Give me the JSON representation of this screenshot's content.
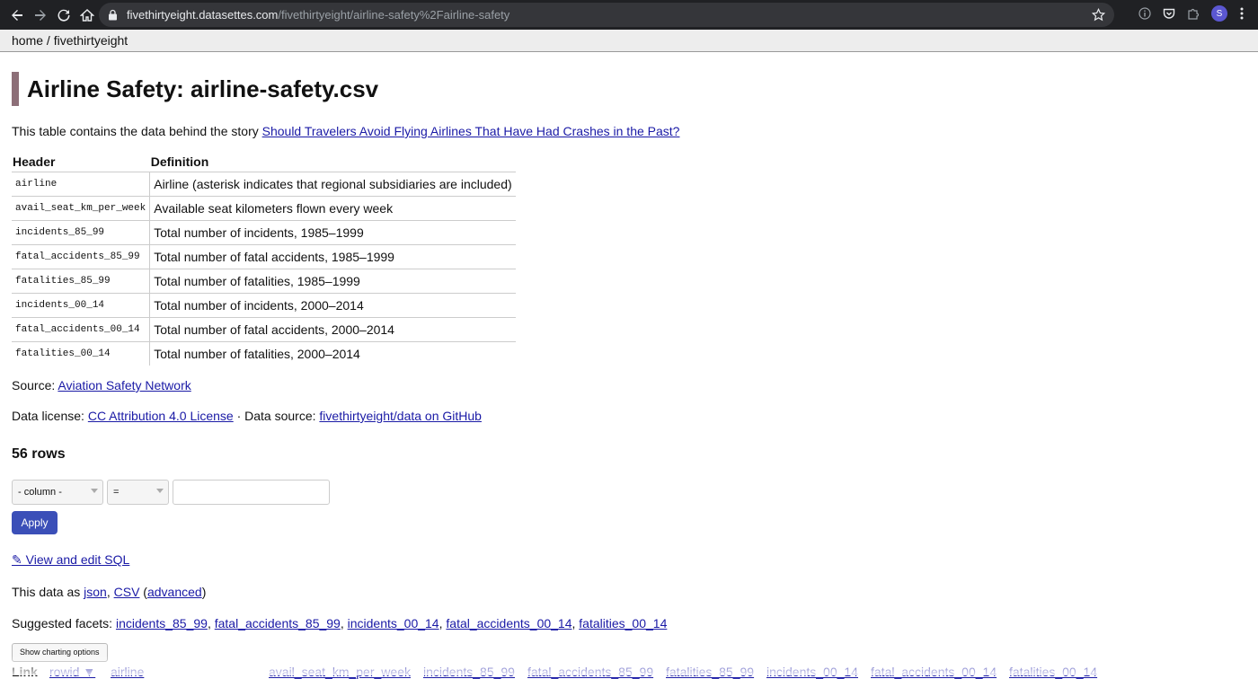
{
  "browser": {
    "url_host": "fivethirtyeight.datasettes.com",
    "url_path": "/fivethirtyeight/airline-safety%2Fairline-safety",
    "profile_initial": "S"
  },
  "breadcrumb": {
    "home": "home",
    "separator": " / ",
    "database": "fivethirtyeight"
  },
  "page": {
    "title": "Airline Safety: airline-safety.csv",
    "description_prefix": "This table contains the data behind the story ",
    "description_link": "Should Travelers Avoid Flying Airlines That Have Had Crashes in the Past?"
  },
  "definitions": {
    "headers": [
      "Header",
      "Definition"
    ],
    "rows": [
      {
        "name": "airline",
        "definition": "Airline (asterisk indicates that regional subsidiaries are included)"
      },
      {
        "name": "avail_seat_km_per_week",
        "definition": "Available seat kilometers flown every week"
      },
      {
        "name": "incidents_85_99",
        "definition": "Total number of incidents, 1985–1999"
      },
      {
        "name": "fatal_accidents_85_99",
        "definition": "Total number of fatal accidents, 1985–1999"
      },
      {
        "name": "fatalities_85_99",
        "definition": "Total number of fatalities, 1985–1999"
      },
      {
        "name": "incidents_00_14",
        "definition": "Total number of incidents, 2000–2014"
      },
      {
        "name": "fatal_accidents_00_14",
        "definition": "Total number of fatal accidents, 2000–2014"
      },
      {
        "name": "fatalities_00_14",
        "definition": "Total number of fatalities, 2000–2014"
      }
    ]
  },
  "source": {
    "label": "Source: ",
    "link": "Aviation Safety Network"
  },
  "license": {
    "label": "Data license: ",
    "link": "CC Attribution 4.0 License",
    "sep": " · Data source: ",
    "source_link": "fivethirtyeight/data on GitHub"
  },
  "row_count": "56 rows",
  "filter": {
    "column_select": "- column -",
    "operator_select": "=",
    "value": "",
    "apply_label": "Apply"
  },
  "sql_link": "✎ View and edit SQL",
  "export": {
    "prefix": "This data as ",
    "json": "json",
    "comma": ", ",
    "csv": "CSV",
    "open_paren": " (",
    "advanced": "advanced",
    "close_paren": ")"
  },
  "facets": {
    "label": "Suggested facets: ",
    "items": [
      "incidents_85_99",
      "fatal_accidents_85_99",
      "incidents_00_14",
      "fatal_accidents_00_14",
      "fatalities_00_14"
    ]
  },
  "chart_button": "Show charting options",
  "column_headers": [
    "Link",
    "rowid ▼",
    "airline",
    "avail_seat_km_per_week",
    "incidents_85_99",
    "fatal_accidents_85_99",
    "fatalities_85_99",
    "incidents_00_14",
    "fatal_accidents_00_14",
    "fatalities_00_14"
  ]
}
